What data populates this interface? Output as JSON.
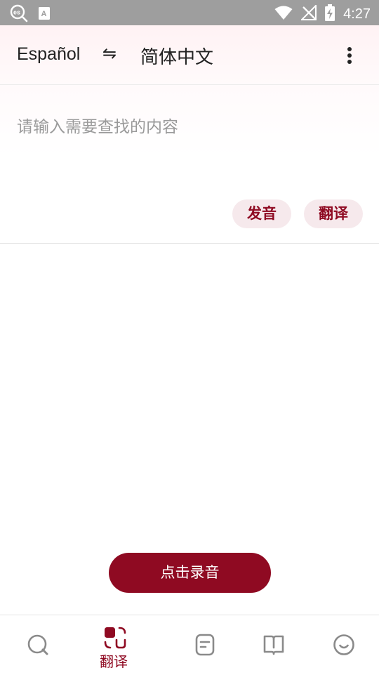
{
  "status_bar": {
    "time": "4:27",
    "icons": [
      "es-search-icon",
      "font-a-icon",
      "wifi-icon",
      "no-signal-icon",
      "battery-charging-icon"
    ]
  },
  "header": {
    "source_language": "Español",
    "swap_icon": "⇋",
    "target_language": "简体中文",
    "menu_icon": "more-vertical-icon"
  },
  "input": {
    "placeholder": "请输入需要查找的内容",
    "speak_button": "发音",
    "translate_button": "翻译"
  },
  "record_button": "点击录音",
  "bottom_nav": {
    "items": [
      {
        "icon": "search-icon",
        "label": ""
      },
      {
        "icon": "translate-scan-icon",
        "label": "翻译",
        "active": true
      },
      {
        "icon": "note-icon",
        "label": ""
      },
      {
        "icon": "book-icon",
        "label": ""
      },
      {
        "icon": "smile-icon",
        "label": ""
      }
    ]
  },
  "colors": {
    "accent": "#8f0a22",
    "pill_bg": "#f6e9ec",
    "status_bar": "#9e9e9e",
    "header_bg": "#fff2f4"
  }
}
